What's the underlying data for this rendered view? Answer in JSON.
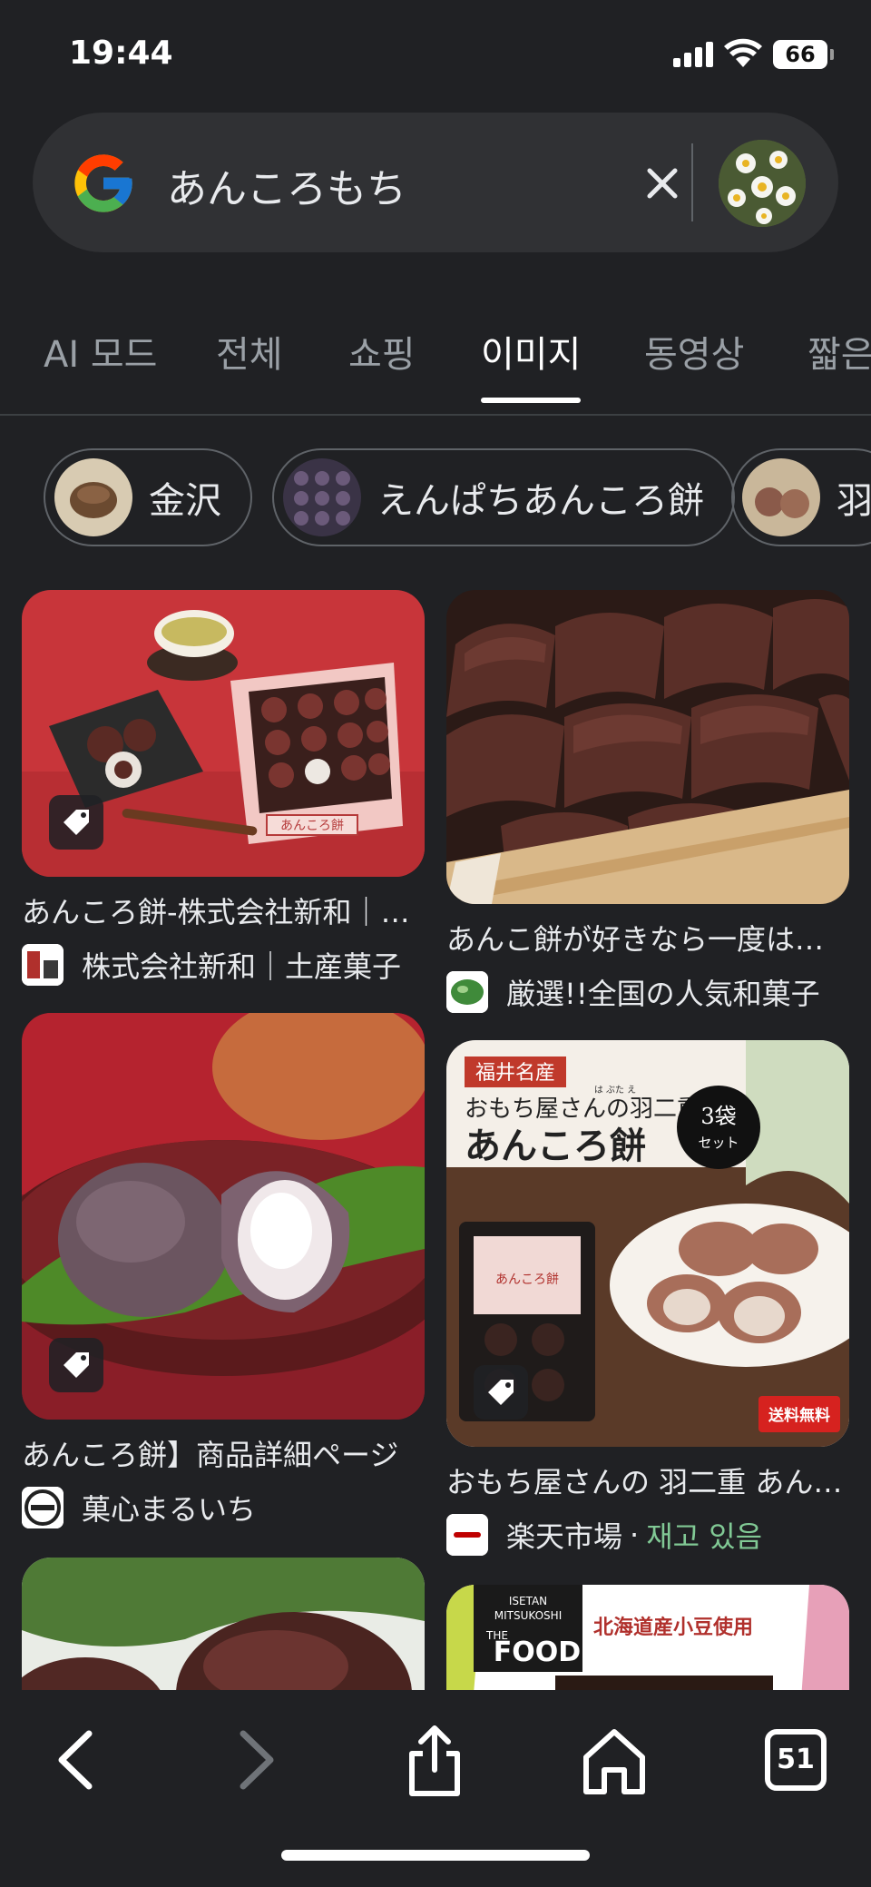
{
  "status_bar": {
    "time": "19:44",
    "battery": "66"
  },
  "search": {
    "query": "あんころもち"
  },
  "tabs": [
    {
      "label": "AI 모드"
    },
    {
      "label": "전체"
    },
    {
      "label": "쇼핑"
    },
    {
      "label": "이미지",
      "active": true
    },
    {
      "label": "동영상"
    },
    {
      "label": "짧은"
    }
  ],
  "chips": [
    {
      "label": "金沢"
    },
    {
      "label": "えんぱちあんころ餅"
    },
    {
      "label": "羽"
    }
  ],
  "results": [
    {
      "title": "あんころ餅-株式会社新和｜土産菓子",
      "source": "株式会社新和｜土産菓子",
      "shopping_tag": true
    },
    {
      "title": "あんこ餅が好きなら一度は食べたい",
      "source": "厳選!!全国の人気和菓子",
      "shopping_tag": false
    },
    {
      "title": "あんころ餅】商品詳細ページ",
      "source": "菓心まるいち",
      "shopping_tag": true
    },
    {
      "title": "おもち屋さんの 羽二重 あんころ餅",
      "source": "楽天市場",
      "stock": "재고 있음",
      "shopping_tag": true
    },
    {
      "title": "",
      "source": ""
    },
    {
      "title": "",
      "source": ""
    }
  ],
  "product_image_text": {
    "region": "福井名産",
    "line1": "おもち屋さんの羽二重",
    "ruby": "は ぶた え",
    "line2": "あんころ餅",
    "badge_top": "3袋",
    "badge_bottom": "セット",
    "shipping": "送料無料",
    "package_label": "あんころ餅",
    "box_label": "あんころ餅"
  },
  "banner_text": {
    "brand1": "ISETAN",
    "brand2": "MITSUKOSHI",
    "brand3": "THE",
    "brand4": "FOOD",
    "tagline": "北海道産小豆使用"
  },
  "bottom_bar": {
    "tab_count": "51"
  }
}
